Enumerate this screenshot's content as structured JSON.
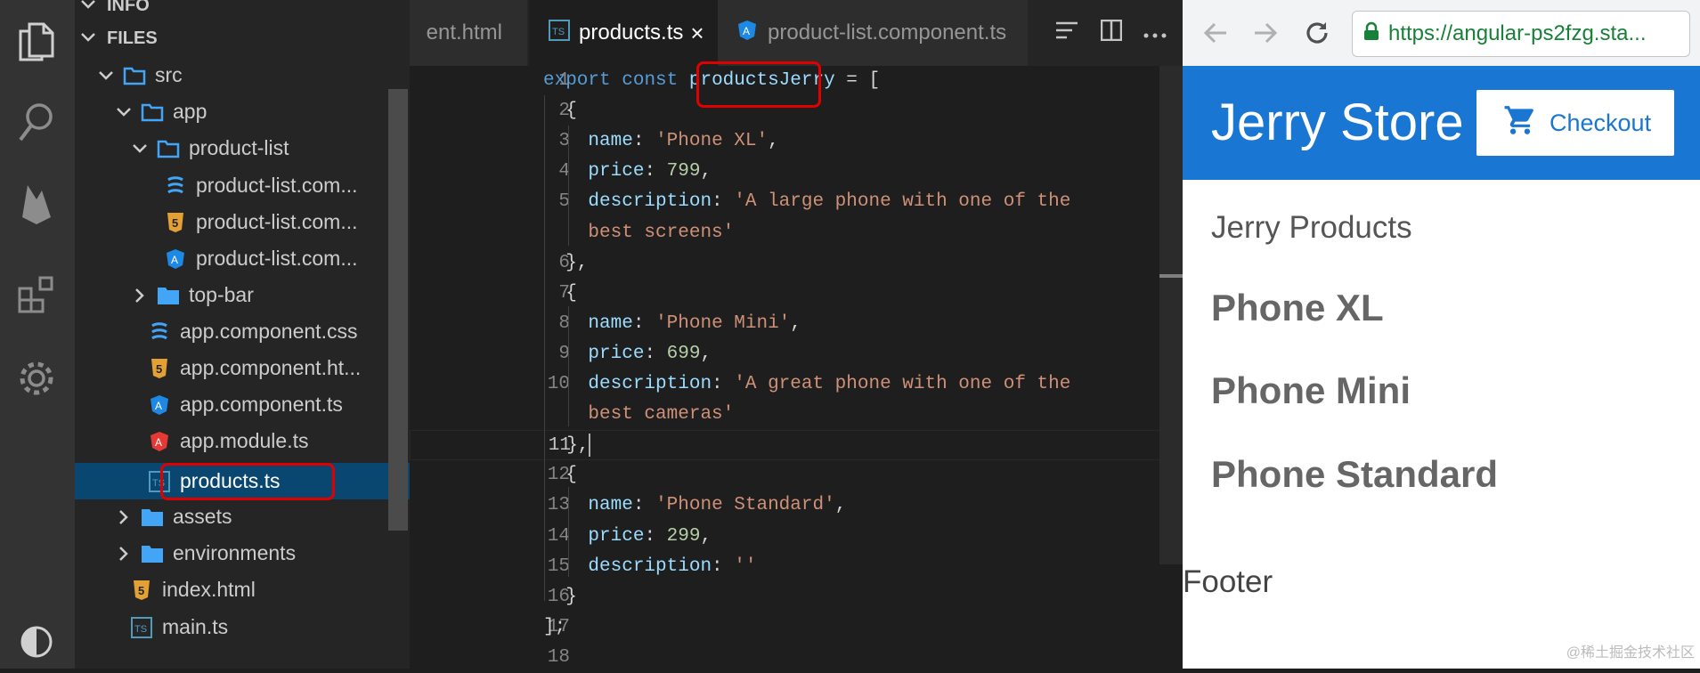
{
  "explorer": {
    "section_info": "INFO",
    "section_files": "FILES",
    "tree": [
      {
        "label": "src",
        "icon": "folder-open-icon"
      },
      {
        "label": "app",
        "icon": "folder-open-icon"
      },
      {
        "label": "product-list",
        "icon": "folder-open-icon"
      },
      {
        "label": "product-list.com...",
        "icon": "css-file-icon"
      },
      {
        "label": "product-list.com...",
        "icon": "html-file-icon"
      },
      {
        "label": "product-list.com...",
        "icon": "angular-file-icon"
      },
      {
        "label": "top-bar",
        "icon": "folder-icon"
      },
      {
        "label": "app.component.css",
        "icon": "css-file-icon"
      },
      {
        "label": "app.component.ht...",
        "icon": "html-file-icon"
      },
      {
        "label": "app.component.ts",
        "icon": "angular-file-icon"
      },
      {
        "label": "app.module.ts",
        "icon": "angular-module-icon"
      },
      {
        "label": "products.ts",
        "icon": "typescript-file-icon"
      },
      {
        "label": "assets",
        "icon": "folder-icon"
      },
      {
        "label": "environments",
        "icon": "folder-icon"
      },
      {
        "label": "index.html",
        "icon": "html-file-icon"
      },
      {
        "label": "main.ts",
        "icon": "typescript-file-icon"
      }
    ]
  },
  "editor": {
    "tabs": [
      {
        "label": "ent.html"
      },
      {
        "label": "products.ts",
        "close": "×"
      },
      {
        "label": "product-list.component.ts"
      }
    ],
    "current_line": 11,
    "lines": [
      {
        "n": "1",
        "t": [
          [
            "kw",
            "export"
          ],
          [
            "pn",
            " "
          ],
          [
            "kw",
            "const"
          ],
          [
            "pn",
            " "
          ],
          [
            "id",
            "productsJerry"
          ],
          [
            "pn",
            " = ["
          ]
        ]
      },
      {
        "n": "2",
        "t": [
          [
            "pn",
            "  {"
          ]
        ]
      },
      {
        "n": "3",
        "t": [
          [
            "pn",
            "    "
          ],
          [
            "id",
            "name"
          ],
          [
            "pn",
            ": "
          ],
          [
            "str",
            "'Phone XL'"
          ],
          [
            "pn",
            ","
          ]
        ]
      },
      {
        "n": "4",
        "t": [
          [
            "pn",
            "    "
          ],
          [
            "id",
            "price"
          ],
          [
            "pn",
            ": "
          ],
          [
            "num",
            "799"
          ],
          [
            "pn",
            ","
          ]
        ]
      },
      {
        "n": "5",
        "t": [
          [
            "pn",
            "    "
          ],
          [
            "id",
            "description"
          ],
          [
            "pn",
            ": "
          ],
          [
            "str",
            "'A large phone with one of the"
          ]
        ]
      },
      {
        "n": "",
        "t": [
          [
            "pn",
            "    "
          ],
          [
            "str",
            "best screens'"
          ]
        ]
      },
      {
        "n": "6",
        "t": [
          [
            "pn",
            "  },"
          ]
        ]
      },
      {
        "n": "7",
        "t": [
          [
            "pn",
            "  {"
          ]
        ]
      },
      {
        "n": "8",
        "t": [
          [
            "pn",
            "    "
          ],
          [
            "id",
            "name"
          ],
          [
            "pn",
            ": "
          ],
          [
            "str",
            "'Phone Mini'"
          ],
          [
            "pn",
            ","
          ]
        ]
      },
      {
        "n": "9",
        "t": [
          [
            "pn",
            "    "
          ],
          [
            "id",
            "price"
          ],
          [
            "pn",
            ": "
          ],
          [
            "num",
            "699"
          ],
          [
            "pn",
            ","
          ]
        ]
      },
      {
        "n": "10",
        "t": [
          [
            "pn",
            "    "
          ],
          [
            "id",
            "description"
          ],
          [
            "pn",
            ": "
          ],
          [
            "str",
            "'A great phone with one of the"
          ]
        ]
      },
      {
        "n": "",
        "t": [
          [
            "pn",
            "    "
          ],
          [
            "str",
            "best cameras'"
          ]
        ]
      },
      {
        "n": "11",
        "t": [
          [
            "pn",
            "  },"
          ]
        ]
      },
      {
        "n": "12",
        "t": [
          [
            "pn",
            "  {"
          ]
        ]
      },
      {
        "n": "13",
        "t": [
          [
            "pn",
            "    "
          ],
          [
            "id",
            "name"
          ],
          [
            "pn",
            ": "
          ],
          [
            "str",
            "'Phone Standard'"
          ],
          [
            "pn",
            ","
          ]
        ]
      },
      {
        "n": "14",
        "t": [
          [
            "pn",
            "    "
          ],
          [
            "id",
            "price"
          ],
          [
            "pn",
            ": "
          ],
          [
            "num",
            "299"
          ],
          [
            "pn",
            ","
          ]
        ]
      },
      {
        "n": "15",
        "t": [
          [
            "pn",
            "    "
          ],
          [
            "id",
            "description"
          ],
          [
            "pn",
            ": "
          ],
          [
            "str",
            "''"
          ]
        ]
      },
      {
        "n": "16",
        "t": [
          [
            "pn",
            "  }"
          ]
        ]
      },
      {
        "n": "17",
        "t": [
          [
            "pn",
            "];"
          ]
        ]
      },
      {
        "n": "18",
        "t": []
      }
    ]
  },
  "browser": {
    "url": "https://angular-ps2fzg.sta...",
    "store_title": "Jerry Store",
    "checkout_label": "Checkout",
    "products_heading": "Jerry Products",
    "products": [
      "Phone XL",
      "Phone Mini",
      "Phone Standard"
    ],
    "footer": "Footer"
  },
  "watermark": "@稀土掘金技术社区",
  "colors": {
    "accent": "#1976d2",
    "highlight": "#e00000",
    "selection": "#094771"
  }
}
